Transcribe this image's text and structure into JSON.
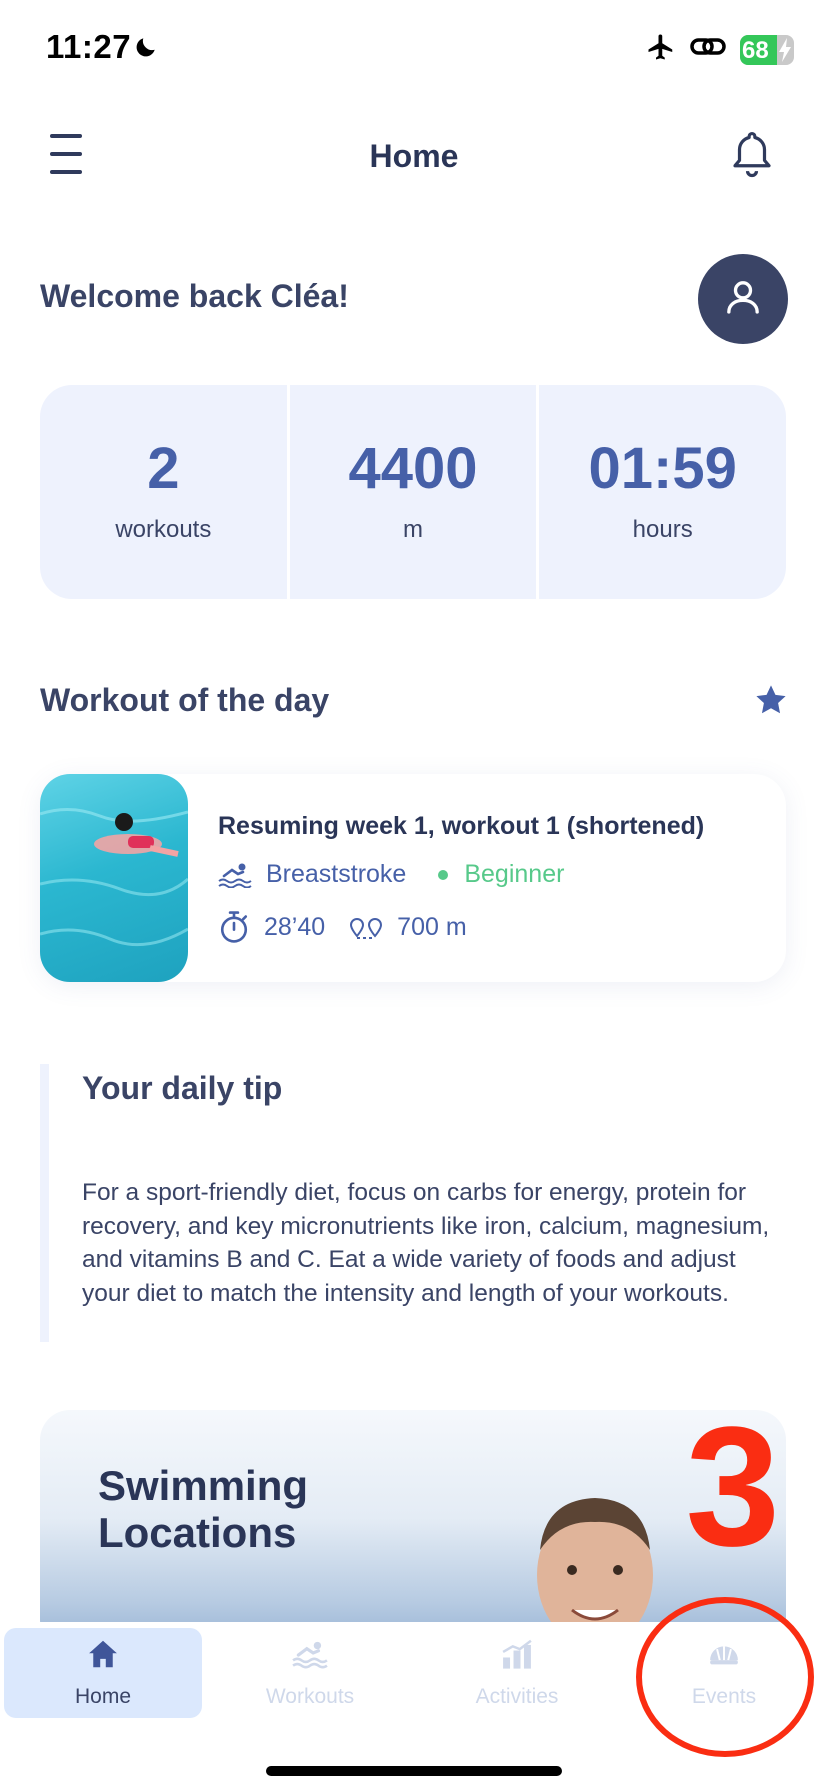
{
  "status_bar": {
    "time": "11:27",
    "battery": "68",
    "icons": [
      "moon-icon",
      "airplane-icon",
      "link-icon",
      "battery-icon",
      "charging-bolt-icon"
    ]
  },
  "header": {
    "title": "Home",
    "icons": [
      "hamburger-menu-icon",
      "bell-icon"
    ]
  },
  "welcome": {
    "text": "Welcome back Cléa!",
    "avatar_icon": "user-icon"
  },
  "stats": [
    {
      "value": "2",
      "label": "workouts"
    },
    {
      "value": "4400",
      "label": "m"
    },
    {
      "value": "01:59",
      "label": "hours"
    }
  ],
  "workout_of_day": {
    "section_title": "Workout of the day",
    "title": "Resuming week 1, workout 1 (shortened)",
    "stroke": "Breaststroke",
    "level": "Beginner",
    "duration": "28’40",
    "distance": "700 m",
    "icons": [
      "star-icon",
      "swimmer-icon",
      "stopwatch-icon",
      "distance-pin-icon"
    ]
  },
  "daily_tip": {
    "title": "Your daily tip",
    "text": "For a sport-friendly diet, focus on carbs for energy, protein for recovery, and key micronutrients like iron, calcium, magnesium, and vitamins B and C. Eat a wide variety of foods and adjust your diet to match the intensity and length of your workouts."
  },
  "locations": {
    "title_line1": "Swimming",
    "title_line2": "Locations",
    "annotation_number": "3"
  },
  "tabbar": {
    "tabs": [
      {
        "label": "Home",
        "icon": "home-icon",
        "active": true
      },
      {
        "label": "Workouts",
        "icon": "swimmer-icon",
        "active": false
      },
      {
        "label": "Activities",
        "icon": "chart-icon",
        "active": false
      },
      {
        "label": "Events",
        "icon": "swim-cap-icon",
        "active": false
      }
    ]
  },
  "colors": {
    "accent": "#4660a8",
    "dark_text": "#3a4466",
    "card_bg": "#eef2fd",
    "level_green": "#57c98a",
    "annotation_red": "#fa2d12"
  }
}
